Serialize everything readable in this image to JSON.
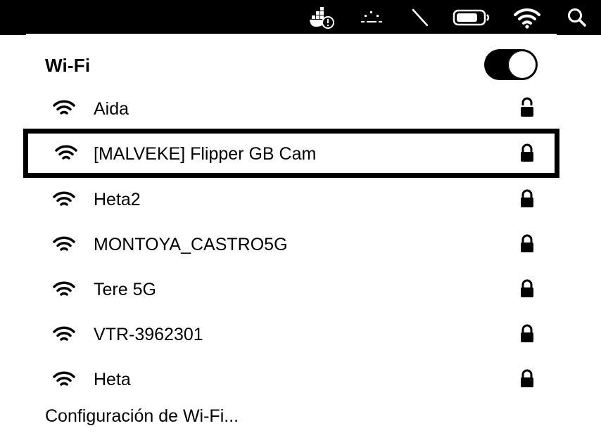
{
  "menubar": {
    "icons": [
      "docker-alert-icon",
      "loading-dots-icon",
      "slash-icon",
      "battery-icon",
      "wifi-icon",
      "search-icon"
    ]
  },
  "panel": {
    "title": "Wi-Fi",
    "toggle_on": true,
    "networks": [
      {
        "name": "Aida",
        "locked": true,
        "selected": false
      },
      {
        "name": "[MALVEKE] Flipper GB Cam",
        "locked": true,
        "selected": true
      },
      {
        "name": "Heta2",
        "locked": true,
        "selected": false
      },
      {
        "name": "MONTOYA_CASTRO5G",
        "locked": true,
        "selected": false
      },
      {
        "name": "Tere 5G",
        "locked": true,
        "selected": false
      },
      {
        "name": "VTR-3962301",
        "locked": true,
        "selected": false
      },
      {
        "name": "Heta",
        "locked": true,
        "selected": false
      }
    ],
    "settings_label": "Configuración de Wi-Fi..."
  },
  "colors": {
    "menubar": "#000000",
    "background": "#ffffff",
    "text": "#000000"
  }
}
